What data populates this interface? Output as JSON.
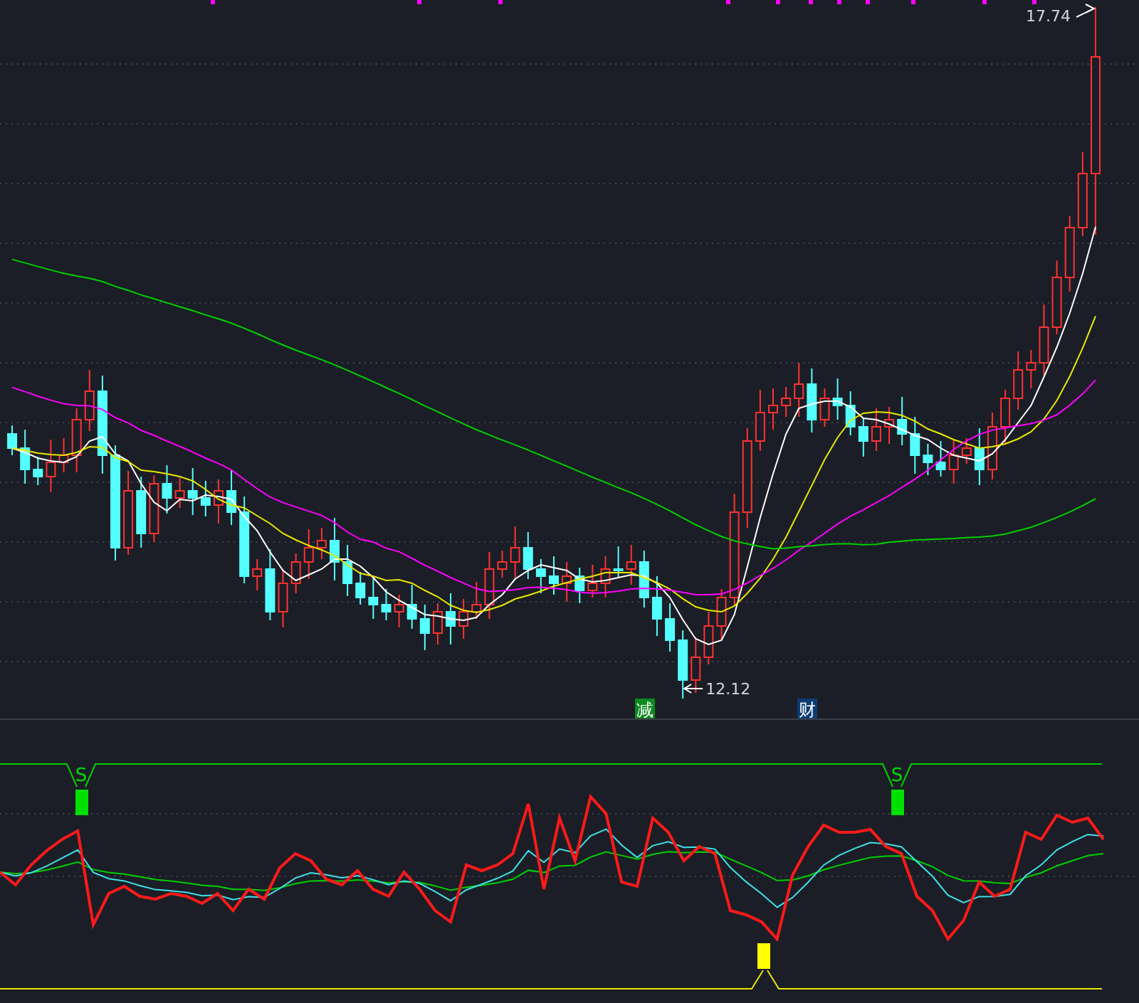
{
  "price_chart": {
    "high_marker": "17.74",
    "low_marker": "12.12",
    "signal_tags": [
      {
        "label": "减",
        "color": "#0a8a1e"
      },
      {
        "label": "财",
        "color": "#0b3c72"
      }
    ]
  },
  "indicator": {
    "signals": [
      {
        "label": "S",
        "kind": "sell"
      },
      {
        "label": "S",
        "kind": "sell"
      }
    ]
  }
}
